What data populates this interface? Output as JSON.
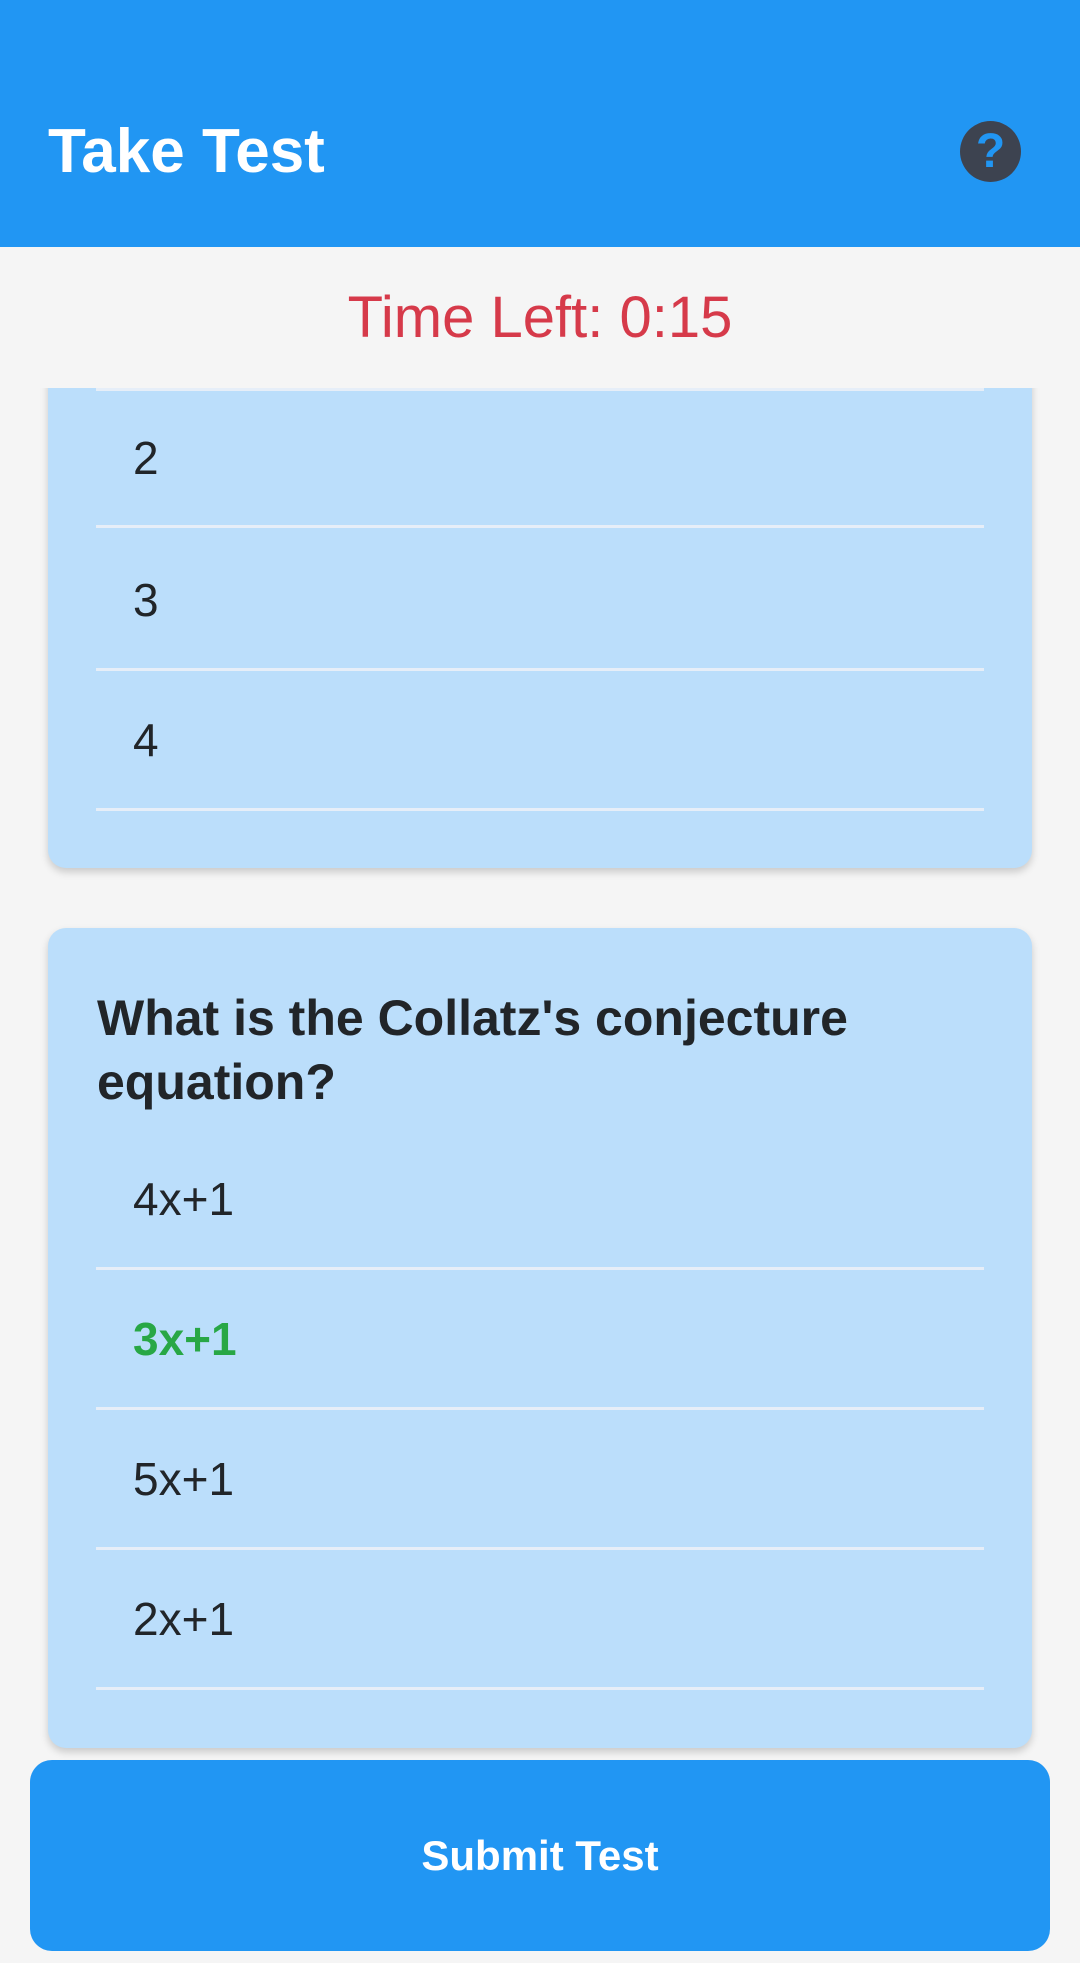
{
  "app_bar": {
    "title": "Take Test",
    "help_icon": "question-circle-icon",
    "colors": {
      "background": "#2196f3",
      "help_bg": "#3d4350"
    }
  },
  "timer": {
    "label": "Time Left: 0:15",
    "color": "#d63a4a"
  },
  "questions": [
    {
      "text": "",
      "options": [
        "2",
        "3",
        "4"
      ]
    },
    {
      "text": "What is the Collatz's conjecture equation?",
      "options": [
        "4x+1",
        "3x+1",
        "5x+1",
        "2x+1"
      ],
      "selected": "3x+1"
    }
  ],
  "submit": {
    "label": "Submit Test"
  },
  "colors": {
    "card": "#bbdefb",
    "selected_option": "#28a745"
  }
}
